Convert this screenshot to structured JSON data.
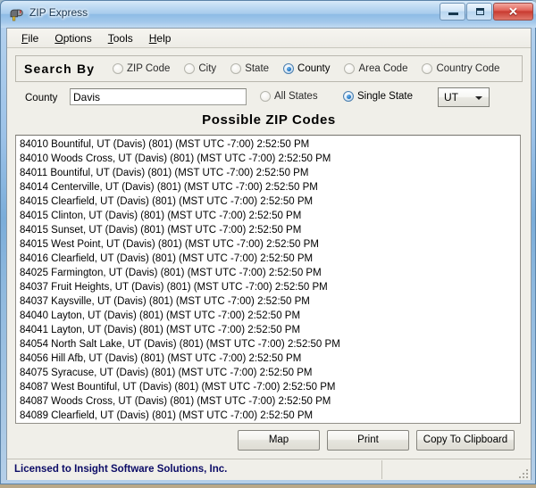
{
  "window": {
    "title": "ZIP Express",
    "icon": "mailbox-icon",
    "minimize_label": "Minimize",
    "maximize_label": "Maximize",
    "close_label": "Close"
  },
  "menu": {
    "items": [
      {
        "label": "File",
        "accel": "F"
      },
      {
        "label": "Options",
        "accel": "O"
      },
      {
        "label": "Tools",
        "accel": "T"
      },
      {
        "label": "Help",
        "accel": "H"
      }
    ]
  },
  "search_by": {
    "label": "Search By",
    "options": [
      {
        "label": "ZIP Code",
        "checked": false
      },
      {
        "label": "City",
        "checked": false
      },
      {
        "label": "State",
        "checked": false
      },
      {
        "label": "County",
        "checked": true
      },
      {
        "label": "Area Code",
        "checked": false
      },
      {
        "label": "Country Code",
        "checked": false
      }
    ]
  },
  "query_row": {
    "field_label": "County",
    "field_value": "Davis",
    "field_placeholder": "",
    "scope_options": [
      {
        "label": "All States",
        "checked": false
      },
      {
        "label": "Single State",
        "checked": true
      }
    ],
    "state_combo": {
      "value": "UT",
      "arrow": "chevron-down-icon"
    }
  },
  "results": {
    "heading": "Possible ZIP Codes",
    "rows": [
      "84010 Bountiful, UT (Davis) (801) (MST  UTC -7:00) 2:52:50 PM",
      "84010 Woods Cross, UT (Davis) (801) (MST  UTC -7:00) 2:52:50 PM",
      "84011 Bountiful, UT (Davis) (801) (MST  UTC -7:00) 2:52:50 PM",
      "84014 Centerville, UT (Davis) (801) (MST  UTC -7:00) 2:52:50 PM",
      "84015 Clearfield, UT (Davis) (801) (MST  UTC -7:00) 2:52:50 PM",
      "84015 Clinton, UT (Davis) (801) (MST  UTC -7:00) 2:52:50 PM",
      "84015 Sunset, UT (Davis) (801) (MST  UTC -7:00) 2:52:50 PM",
      "84015 West Point, UT (Davis) (801) (MST  UTC -7:00) 2:52:50 PM",
      "84016 Clearfield, UT (Davis) (801) (MST  UTC -7:00) 2:52:50 PM",
      "84025 Farmington, UT (Davis) (801) (MST  UTC -7:00) 2:52:50 PM",
      "84037 Fruit Heights, UT (Davis) (801) (MST  UTC -7:00) 2:52:50 PM",
      "84037 Kaysville, UT (Davis) (801) (MST  UTC -7:00) 2:52:50 PM",
      "84040 Layton, UT (Davis) (801) (MST  UTC -7:00) 2:52:50 PM",
      "84041 Layton, UT (Davis) (801) (MST  UTC -7:00) 2:52:50 PM",
      "84054 North Salt Lake, UT (Davis) (801) (MST  UTC -7:00) 2:52:50 PM",
      "84056 Hill Afb, UT (Davis) (801) (MST  UTC -7:00) 2:52:50 PM",
      "84075 Syracuse, UT (Davis) (801) (MST  UTC -7:00) 2:52:50 PM",
      "84087 West Bountiful, UT (Davis) (801) (MST  UTC -7:00) 2:52:50 PM",
      "84087 Woods Cross, UT (Davis) (801) (MST  UTC -7:00) 2:52:50 PM",
      "84089 Clearfield, UT (Davis) (801) (MST  UTC -7:00) 2:52:50 PM"
    ]
  },
  "actions": {
    "map": "Map",
    "print": "Print",
    "copy": "Copy To Clipboard"
  },
  "status": {
    "license_text": "Licensed to Insight Software Solutions, Inc.",
    "grip": "resize-grip-icon"
  },
  "colors": {
    "accent": "#1c6fbb",
    "status_text": "#0b0b66",
    "client_bg": "#f0efe9",
    "list_bg": "#ffffff",
    "close_button": "#c93b31"
  }
}
